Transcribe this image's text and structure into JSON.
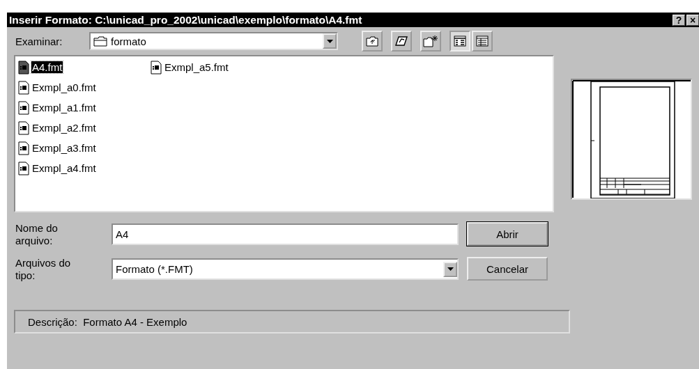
{
  "window": {
    "title": "Inserir Formato: C:\\unicad_pro_2002\\unicad\\exemplo\\formato\\A4.fmt",
    "help_button": "?",
    "close_button": "×"
  },
  "look_in": {
    "label": "Examinar:",
    "value": "formato"
  },
  "toolbar": [
    {
      "kind": "up",
      "selected": false
    },
    {
      "kind": "desktop",
      "selected": false
    },
    {
      "kind": "newfolder",
      "selected": false
    },
    {
      "kind": "list",
      "selected": true
    },
    {
      "kind": "details",
      "selected": false
    }
  ],
  "files": [
    {
      "name": "A4.fmt",
      "selected": true
    },
    {
      "name": "Exmpl_a0.fmt",
      "selected": false
    },
    {
      "name": "Exmpl_a1.fmt",
      "selected": false
    },
    {
      "name": "Exmpl_a2.fmt",
      "selected": false
    },
    {
      "name": "Exmpl_a3.fmt",
      "selected": false
    },
    {
      "name": "Exmpl_a4.fmt",
      "selected": false
    },
    {
      "name": "Exmpl_a5.fmt",
      "selected": false
    }
  ],
  "file_name": {
    "label": "Nome do arquivo:",
    "value": "A4"
  },
  "file_type": {
    "label": "Arquivos do tipo:",
    "value": "Formato (*.FMT)"
  },
  "buttons": [
    {
      "label": "Abrir",
      "default": true
    },
    {
      "label": "Cancelar",
      "default": false
    }
  ],
  "description": {
    "label": "Descrição:",
    "value": "Formato A4 - Exemplo"
  }
}
